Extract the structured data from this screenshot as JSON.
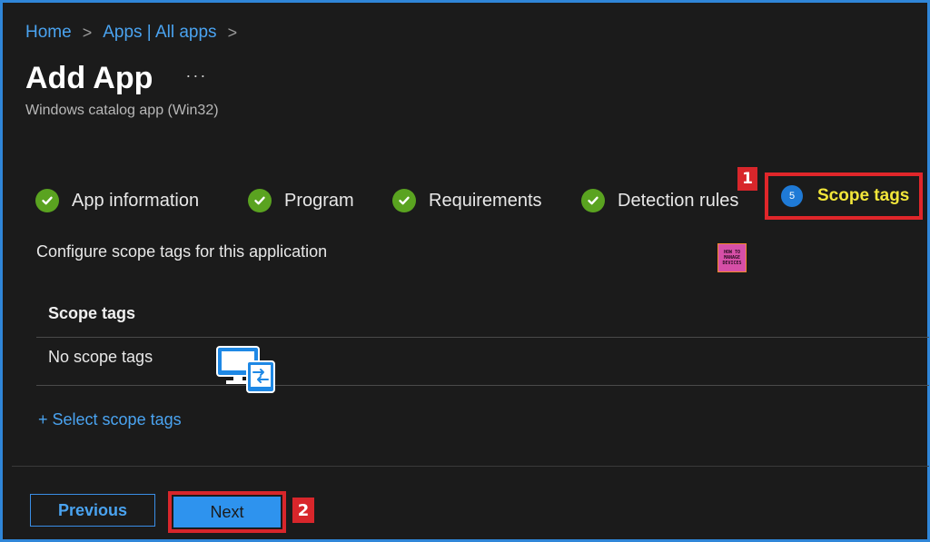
{
  "breadcrumb": {
    "items": [
      "Home",
      "Apps | All apps"
    ],
    "separator": ">"
  },
  "header": {
    "title": "Add App",
    "more": "···",
    "subtitle": "Windows catalog app (Win32)"
  },
  "wizard": {
    "steps": [
      {
        "label": "App information",
        "status": "complete",
        "icon": "check-circle-icon"
      },
      {
        "label": "Program",
        "status": "complete",
        "icon": "check-circle-icon"
      },
      {
        "label": "Requirements",
        "status": "complete",
        "icon": "check-circle-icon"
      },
      {
        "label": "Detection rules",
        "status": "complete",
        "icon": "check-circle-icon"
      },
      {
        "label": "Scope tags",
        "status": "current",
        "number": "5"
      }
    ]
  },
  "annotations": {
    "badge1": "1",
    "badge2": "2"
  },
  "scope": {
    "description": "Configure scope tags for this application",
    "column_header": "Scope tags",
    "empty_text": "No scope tags",
    "select_link": "+ Select scope tags"
  },
  "logo": {
    "line1": "HOW TO",
    "line2": "MANAGE",
    "line3": "DEVICES"
  },
  "footer": {
    "previous_label": "Previous",
    "next_label": "Next"
  },
  "colors": {
    "accent": "#2e93ee",
    "link": "#4aa3f0",
    "success": "#5aa320",
    "highlight": "#d8262b",
    "active_text": "#f2e63a"
  }
}
